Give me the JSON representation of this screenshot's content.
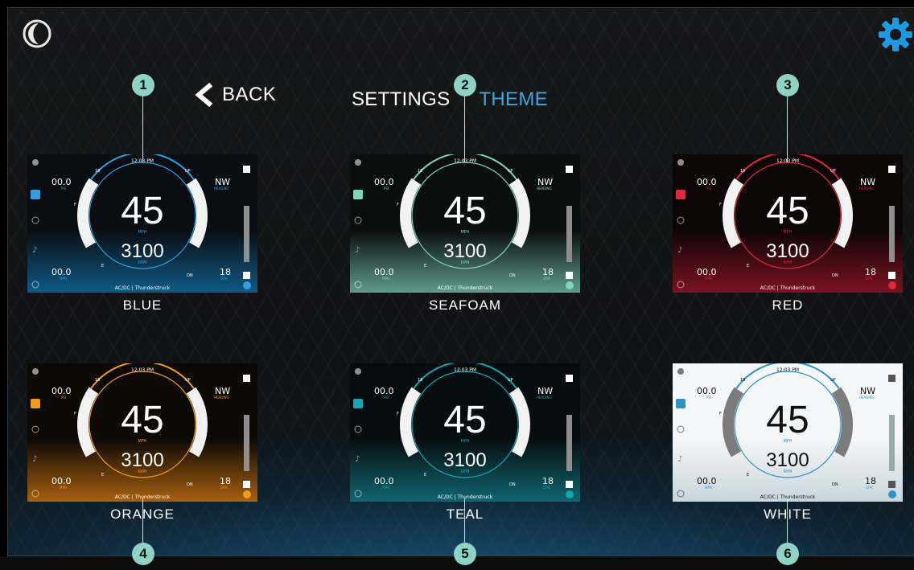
{
  "header": {
    "back_label": "BACK",
    "breadcrumb": "SETTINGS",
    "current": "THEME",
    "moon_icon": "moon-icon",
    "gear_icon": "gear-icon",
    "gear_color": "#1e9be0"
  },
  "dash": {
    "time": "12:03 PM",
    "speed": "45",
    "speed_unit": "MPH",
    "rpm": "3100",
    "rpm_unit": "RPM",
    "heading": "NW",
    "heading_label": "HEADING",
    "oil_value": "00.0",
    "oil_unit": "PSI",
    "temp_value": "00.0",
    "temp_unit": "MPH",
    "fuel_value": "18",
    "fuel_unit": "GPH",
    "volt_label": "18",
    "up_label": "UP",
    "dn_label": "DN",
    "f_label": "F",
    "e_label": "E",
    "media": "AC/DC | Thunderstruck"
  },
  "themes": [
    {
      "name": "BLUE",
      "accent": "#2f9fe0",
      "bg_top": "#0a0d12",
      "bg_bottom": "#0f5a86",
      "fg": "#ffffff",
      "callout": "1"
    },
    {
      "name": "SEAFOAM",
      "accent": "#7fd4bf",
      "bg_top": "#0a0e0d",
      "bg_bottom": "#5f9b8e",
      "fg": "#ffffff",
      "callout": "2"
    },
    {
      "name": "RED",
      "accent": "#e0283c",
      "bg_top": "#0d0607",
      "bg_bottom": "#7a1220",
      "fg": "#ffffff",
      "callout": "3"
    },
    {
      "name": "ORANGE",
      "accent": "#f39a1f",
      "bg_top": "#0d0905",
      "bg_bottom": "#a8600e",
      "fg": "#ffffff",
      "callout": "4"
    },
    {
      "name": "TEAL",
      "accent": "#14a6b4",
      "bg_top": "#060d0f",
      "bg_bottom": "#0f6670",
      "fg": "#ffffff",
      "callout": "5"
    },
    {
      "name": "WHITE",
      "accent": "#2e93c4",
      "bg_top": "#f4f6f7",
      "bg_bottom": "#c9d6dc",
      "fg": "#111111",
      "callout": "6"
    }
  ]
}
